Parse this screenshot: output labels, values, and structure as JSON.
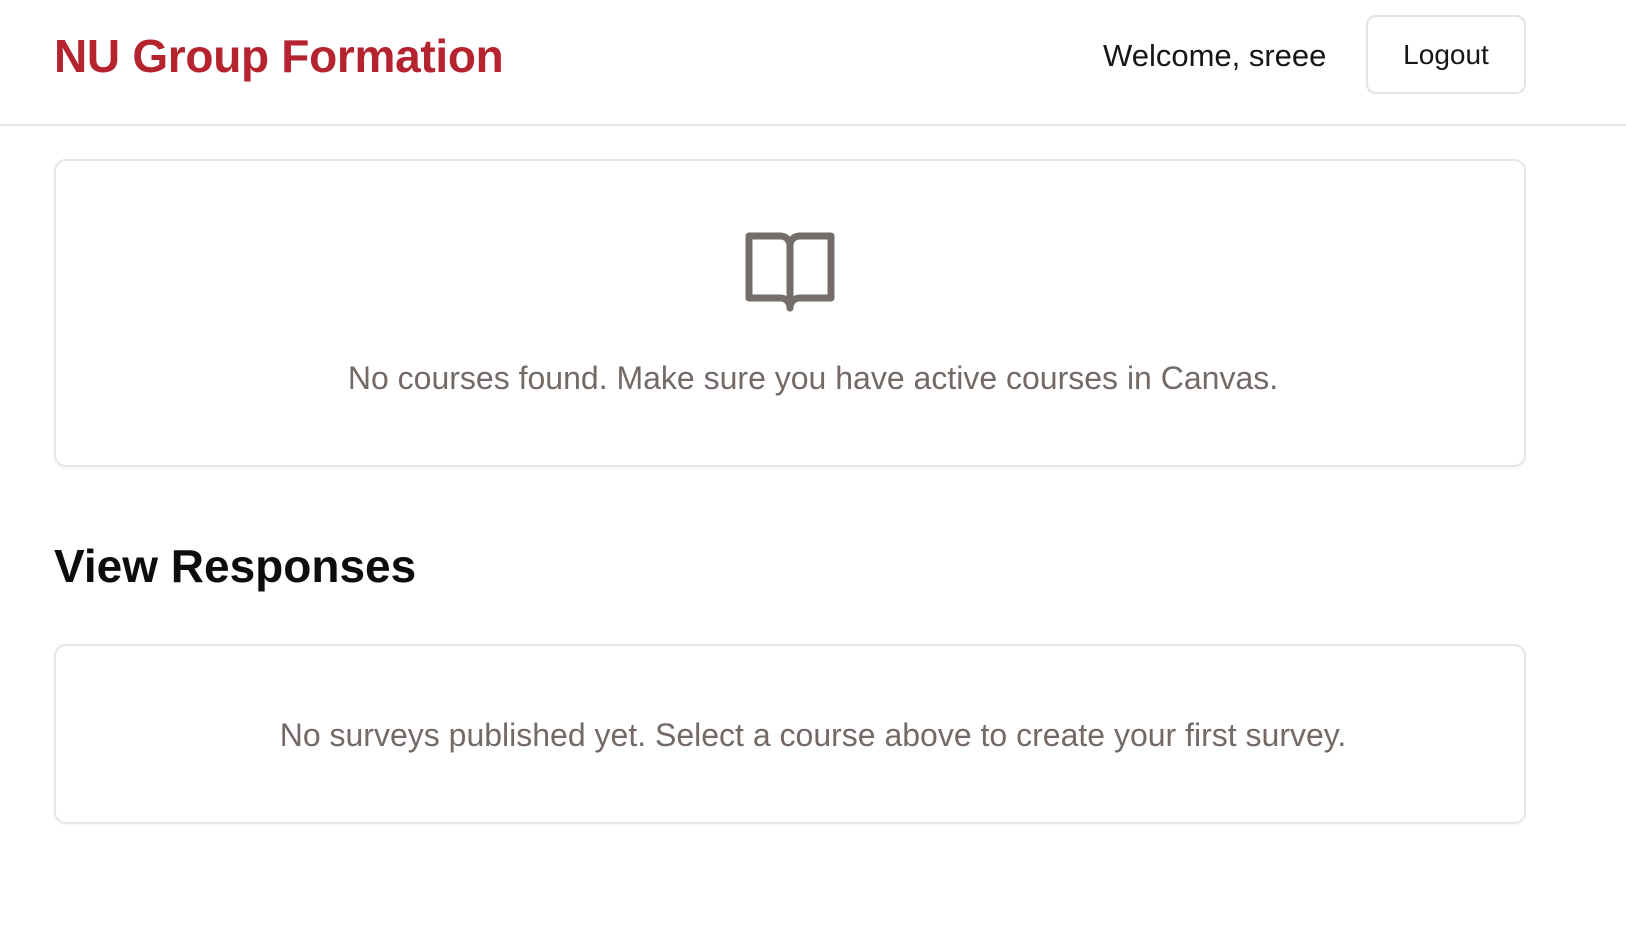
{
  "header": {
    "brand": "NU Group Formation",
    "welcome": "Welcome, sreee",
    "logout_label": "Logout"
  },
  "courses": {
    "icon": "open-book-icon",
    "empty_message": "No courses found. Make sure you have active courses in Canvas."
  },
  "responses": {
    "title": "View Responses",
    "empty_message": "No surveys published yet. Select a course above to create your first survey."
  },
  "colors": {
    "brand": "#b5232e",
    "muted_text": "#736a66",
    "icon": "#756d69"
  }
}
